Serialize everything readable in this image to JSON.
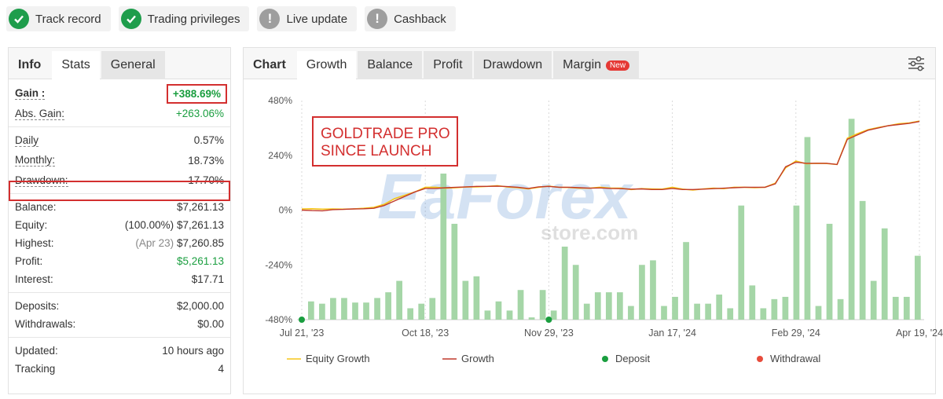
{
  "badges": [
    {
      "label": "Track record",
      "status": "ok"
    },
    {
      "label": "Trading privileges",
      "status": "ok"
    },
    {
      "label": "Live update",
      "status": "warn"
    },
    {
      "label": "Cashback",
      "status": "warn"
    }
  ],
  "left_tabs": [
    "Info",
    "Stats",
    "General"
  ],
  "stats": {
    "gain": {
      "label": "Gain :",
      "value": "+388.69%"
    },
    "abs_gain": {
      "label": "Abs. Gain:",
      "value": "+263.06%"
    },
    "daily": {
      "label": "Daily",
      "value": "0.57%"
    },
    "monthly": {
      "label": "Monthly:",
      "value": "18.73%"
    },
    "drawdown": {
      "label": "Drawdown:",
      "value": "17.70%"
    },
    "balance": {
      "label": "Balance:",
      "value": "$7,261.13"
    },
    "equity": {
      "label": "Equity:",
      "prefix": "(100.00%)",
      "value": "$7,261.13"
    },
    "highest": {
      "label": "Highest:",
      "prefix": "(Apr 23)",
      "value": "$7,260.85"
    },
    "profit": {
      "label": "Profit:",
      "value": "$5,261.13"
    },
    "interest": {
      "label": "Interest:",
      "value": "$17.71"
    },
    "deposits": {
      "label": "Deposits:",
      "value": "$2,000.00"
    },
    "withdrawals": {
      "label": "Withdrawals:",
      "value": "$0.00"
    },
    "updated": {
      "label": "Updated:",
      "value": "10 hours ago"
    },
    "tracking": {
      "label": "Tracking",
      "value": "4"
    }
  },
  "right_tabs": [
    "Chart",
    "Growth",
    "Balance",
    "Profit",
    "Drawdown",
    "Margin"
  ],
  "new_tag": "New",
  "annotation": {
    "line1": "GOLDTRADE PRO",
    "line2": "SINCE LAUNCH"
  },
  "watermark": {
    "text": "EaForex",
    "sub": "store.com"
  },
  "colors": {
    "green": "#1a9e3f",
    "red_box": "#d32f2f",
    "equity": "#f5c518",
    "growth": "#c0392b",
    "bars": "#a5d6a7",
    "deposit": "#1a9e3f",
    "withdrawal": "#e74c3c"
  },
  "chart_data": {
    "type": "bar+line",
    "y_ticks": [
      "480%",
      "240%",
      "0%",
      "-240%",
      "-480%"
    ],
    "ylim": [
      -480,
      480
    ],
    "x_ticks": [
      "Jul 21, '23",
      "Oct 18, '23",
      "Nov 29, '23",
      "Jan 17, '24",
      "Feb 29, '24",
      "Apr 19, '24"
    ],
    "legend": [
      "Equity Growth",
      "Growth",
      "Deposit",
      "Withdrawal"
    ],
    "bars": [
      -400,
      -410,
      -385,
      -385,
      -405,
      -405,
      -385,
      -360,
      -310,
      -430,
      -410,
      -385,
      160,
      -60,
      -310,
      -290,
      -440,
      -400,
      -440,
      -350,
      -470,
      -350,
      -440,
      -160,
      -240,
      -410,
      -360,
      -360,
      -360,
      -420,
      -240,
      -220,
      -420,
      -380,
      -140,
      -410,
      -410,
      -370,
      -430,
      20,
      -330,
      -430,
      -390,
      -380,
      20,
      320,
      -420,
      -60,
      -390,
      400,
      40,
      -310,
      -80,
      -380,
      -380,
      -200
    ],
    "growth": [
      0,
      -2,
      -3,
      2,
      3,
      5,
      6,
      8,
      20,
      40,
      60,
      80,
      95,
      95,
      98,
      100,
      102,
      104,
      104,
      105,
      103,
      100,
      95,
      102,
      104,
      100,
      100,
      98,
      96,
      97,
      95,
      94,
      92,
      93,
      90,
      90,
      95,
      90,
      90,
      92,
      94,
      96,
      98,
      100,
      100,
      100,
      115,
      190,
      210,
      205,
      205,
      205,
      200,
      310,
      330,
      350,
      360,
      370,
      375,
      380,
      388
    ],
    "equity_growth": [
      5,
      6,
      4,
      5,
      4,
      5,
      8,
      12,
      25,
      50,
      65,
      80,
      100,
      100,
      96,
      98,
      101,
      102,
      104,
      107,
      101,
      98,
      93,
      100,
      105,
      100,
      99,
      96,
      96,
      100,
      96,
      96,
      90,
      94,
      93,
      92,
      100,
      92,
      88,
      93,
      96,
      94,
      100,
      100,
      98,
      100,
      118,
      185,
      215,
      203,
      205,
      204,
      200,
      315,
      335,
      352,
      362,
      370,
      378,
      382,
      390
    ],
    "deposits": [
      {
        "x": "Jul 21, '23"
      },
      {
        "x": "Nov 29, '23"
      }
    ]
  }
}
